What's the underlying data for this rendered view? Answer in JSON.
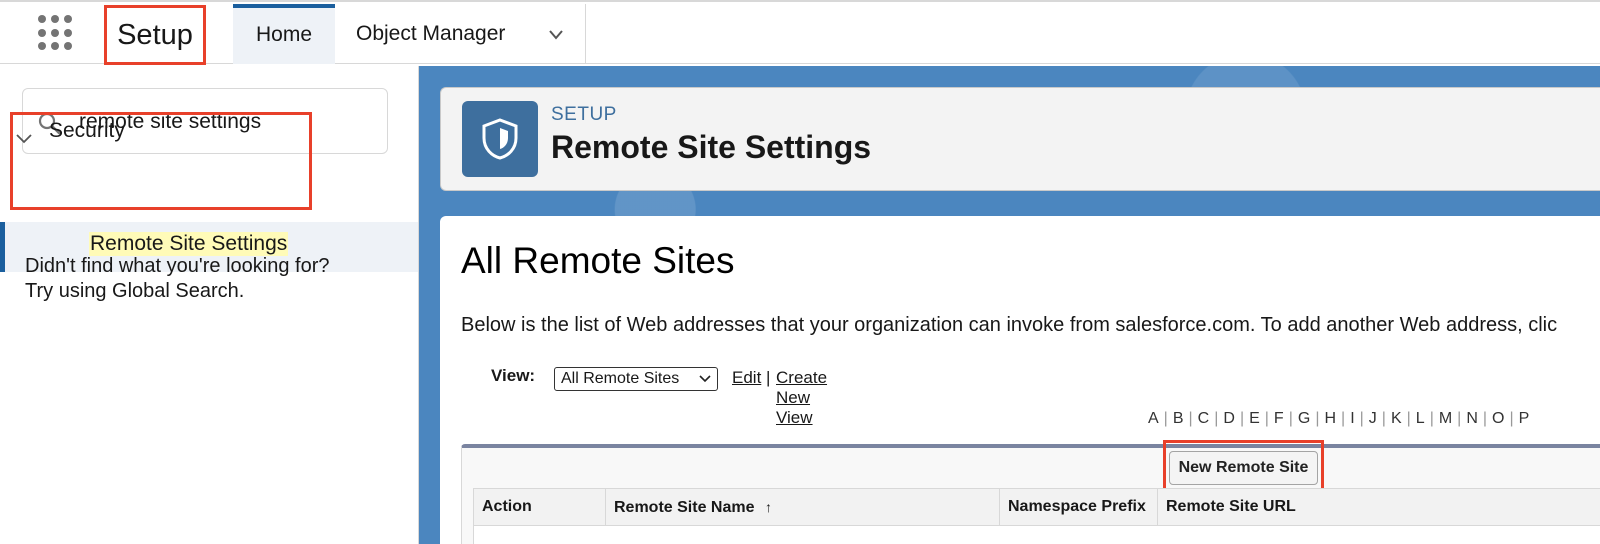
{
  "topbar": {
    "app_name": "Setup",
    "tabs": [
      {
        "label": "Home"
      },
      {
        "label": "Object Manager"
      }
    ]
  },
  "sidebar": {
    "search_value": "remote site settings",
    "tree": {
      "section": "Security",
      "item": "Remote Site Settings"
    },
    "help_line1": "Didn't find what you're looking for?",
    "help_line2": "Try using Global Search."
  },
  "header": {
    "eyebrow": "SETUP",
    "title": "Remote Site Settings"
  },
  "main": {
    "list_title": "All Remote Sites",
    "description": "Below is the list of Web addresses that your organization can invoke from salesforce.com. To add another Web address, clic",
    "view": {
      "label": "View:",
      "selected": "All Remote Sites",
      "edit": "Edit",
      "separator": "|",
      "create": "Create New View"
    },
    "alphabet": [
      "A",
      "B",
      "C",
      "D",
      "E",
      "F",
      "G",
      "H",
      "I",
      "J",
      "K",
      "L",
      "M",
      "N",
      "O",
      "P"
    ],
    "new_button": "New Remote Site",
    "columns": [
      "Action",
      "Remote Site Name",
      "Namespace Prefix",
      "Remote Site URL"
    ],
    "sort_indicator": "↑"
  },
  "colors": {
    "highlight_box": "#e8402a",
    "brand_blue": "#1b5f9e",
    "icon_tile": "#3e6f9e",
    "search_highlight": "#fffbb8"
  }
}
